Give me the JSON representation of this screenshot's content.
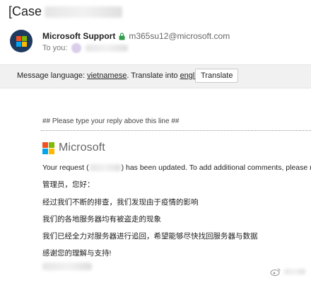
{
  "email": {
    "subject_prefix": "[Case",
    "sender": {
      "name": "Microsoft Support",
      "email": "m365su12@microsoft.com",
      "to_label": "To you:"
    }
  },
  "translate_bar": {
    "prefix": "Message language: ",
    "source_language": "vietnamese",
    "middle": ". Translate into ",
    "target_language": "english",
    "suffix": "?",
    "button_label": "Translate"
  },
  "body": {
    "reply_marker": "## Please type your reply above this line ##",
    "brand": "Microsoft",
    "request_prefix": "Your request (",
    "request_suffix": ") has been updated. To add additional comments, please r",
    "greeting": "管理员，您好：",
    "paragraphs": [
      "经过我们不断的排查，我们发现由于疫情的影响",
      "我们的各地服务器均有被盗走的现象",
      "我们已经全力对服务器进行追回，希望能够尽快找回服务器与数据",
      "感谢您的理解与支持!"
    ]
  },
  "colors": {
    "ms_red": "#f25022",
    "ms_green": "#7fba00",
    "ms_blue": "#00a4ef",
    "ms_yellow": "#ffb900",
    "avatar_bg": "#1f3a5f",
    "translate_bar_bg": "#f1f1f1"
  },
  "icons": {
    "avatar": "microsoft-logo",
    "lock": "lock-icon",
    "watermark": "weibo-icon"
  }
}
